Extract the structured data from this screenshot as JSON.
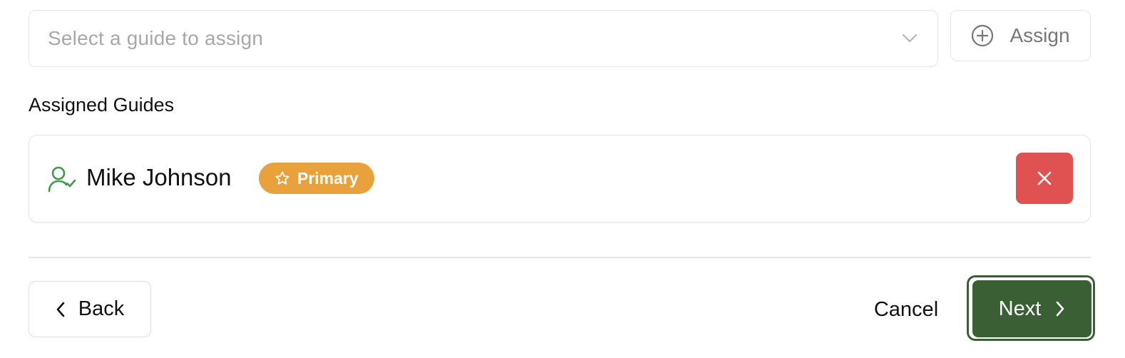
{
  "guide_select": {
    "placeholder": "Select a guide to assign",
    "icon": "chevron-down-icon"
  },
  "assign_button": {
    "label": "Assign",
    "icon": "plus-circle-icon"
  },
  "assigned_section": {
    "title": "Assigned Guides",
    "guides": [
      {
        "name": "Mike Johnson",
        "icon": "user-check-icon",
        "badge": {
          "label": "Primary",
          "icon": "star-icon",
          "color": "#e9a23b"
        },
        "remove_icon": "close-icon",
        "remove_color": "#e05252"
      }
    ]
  },
  "footer": {
    "back_label": "Back",
    "cancel_label": "Cancel",
    "next_label": "Next",
    "next_color": "#3a5f34"
  }
}
